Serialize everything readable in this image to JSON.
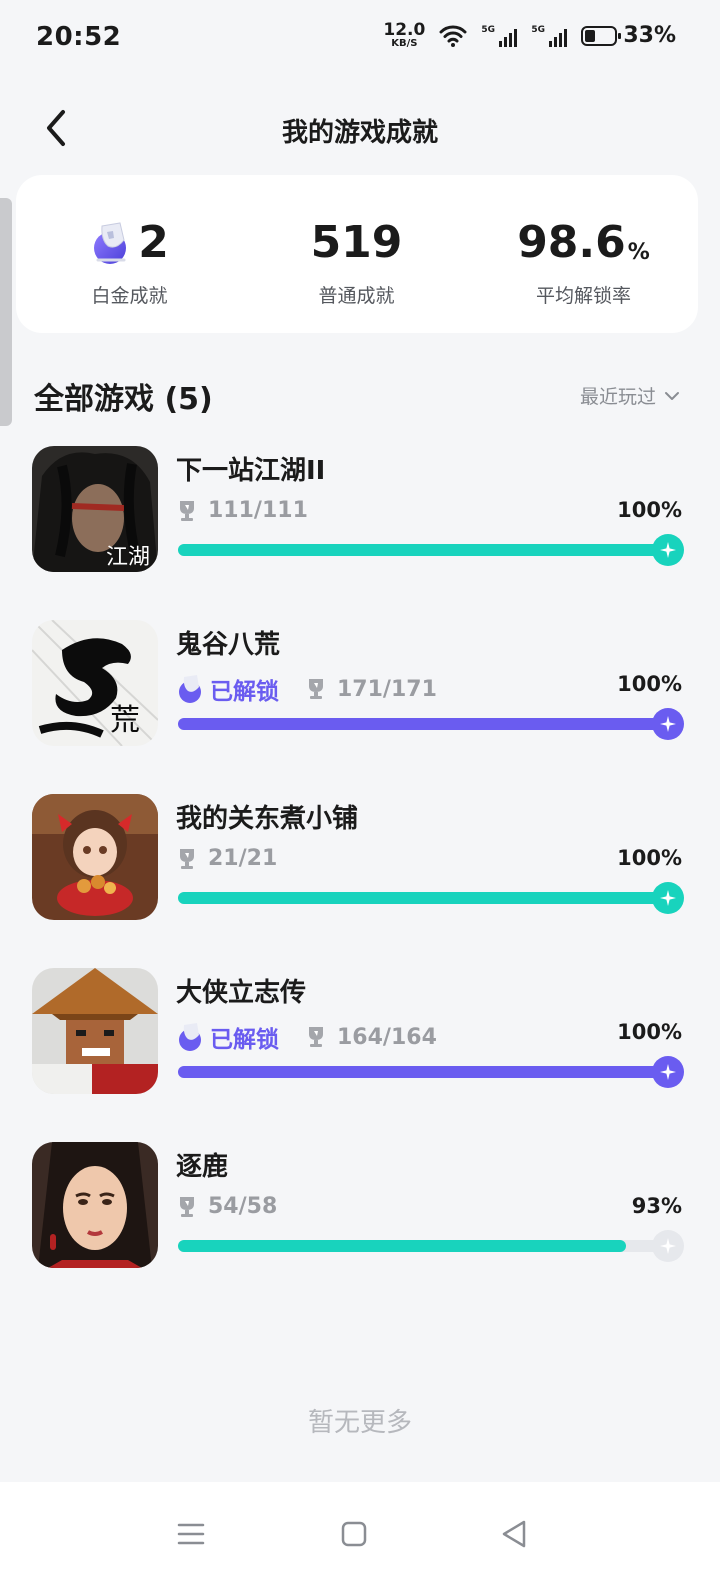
{
  "status_bar": {
    "time": "20:52",
    "net_speed_value": "12.0",
    "net_speed_unit": "KB/S",
    "signal1_tag": "5G",
    "signal2_tag": "5G",
    "battery": "33%",
    "battery_level": 0.33
  },
  "header": {
    "title": "我的游戏成就"
  },
  "summary": {
    "platinum": {
      "value": "2",
      "label": "白金成就"
    },
    "normal": {
      "value": "519",
      "label": "普通成就"
    },
    "rate": {
      "value": "98.6",
      "unit": "%",
      "label": "平均解锁率"
    }
  },
  "section": {
    "title": "全部游戏 (5)",
    "sort_label": "最近玩过"
  },
  "games": [
    {
      "name": "下一站江湖II",
      "badge": "",
      "trophies": "111/111",
      "percent": "100%",
      "progress": 1.0,
      "color": "#18d3bd",
      "cover_text": "江湖"
    },
    {
      "name": "鬼谷八荒",
      "badge": "已解锁",
      "trophies": "171/171",
      "percent": "100%",
      "progress": 1.0,
      "color": "#6a5cf0",
      "cover_text": "荒"
    },
    {
      "name": "我的关东煮小铺",
      "badge": "",
      "trophies": "21/21",
      "percent": "100%",
      "progress": 1.0,
      "color": "#18d3bd",
      "cover_text": ""
    },
    {
      "name": "大侠立志传",
      "badge": "已解锁",
      "trophies": "164/164",
      "percent": "100%",
      "progress": 1.0,
      "color": "#6a5cf0",
      "cover_text": ""
    },
    {
      "name": "逐鹿",
      "badge": "",
      "trophies": "54/58",
      "percent": "93%",
      "progress": 0.93,
      "color": "#18d3bd",
      "cover_text": ""
    }
  ],
  "footer": {
    "no_more": "暂无更多"
  },
  "colors": {
    "accent_teal": "#18d3bd",
    "accent_purple": "#6a5cf0"
  },
  "icons": [
    "back-arrow-icon",
    "chevron-down-icon",
    "trophy-icon",
    "platinum-trophy-icon",
    "star-sparkle-icon",
    "menu-icon",
    "home-square-icon",
    "back-triangle-icon"
  ]
}
